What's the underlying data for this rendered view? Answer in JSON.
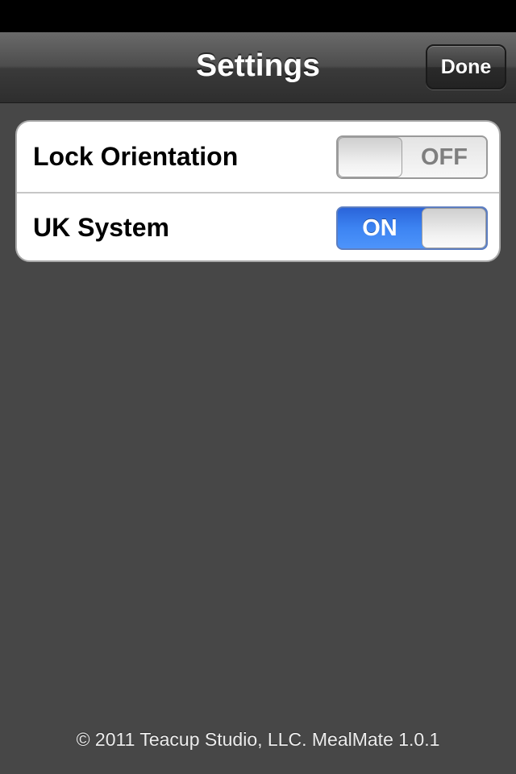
{
  "nav": {
    "title": "Settings",
    "done_label": "Done"
  },
  "settings": {
    "items": [
      {
        "label": "Lock Orientation",
        "switch_text": "OFF",
        "state": "off"
      },
      {
        "label": "UK System",
        "switch_text": "ON",
        "state": "on"
      }
    ]
  },
  "footer": {
    "text": "© 2011 Teacup Studio, LLC. MealMate 1.0.1"
  },
  "colors": {
    "background": "#474747",
    "switch_on": "#3d84f2",
    "nav_bar": "#3a3a3a"
  }
}
